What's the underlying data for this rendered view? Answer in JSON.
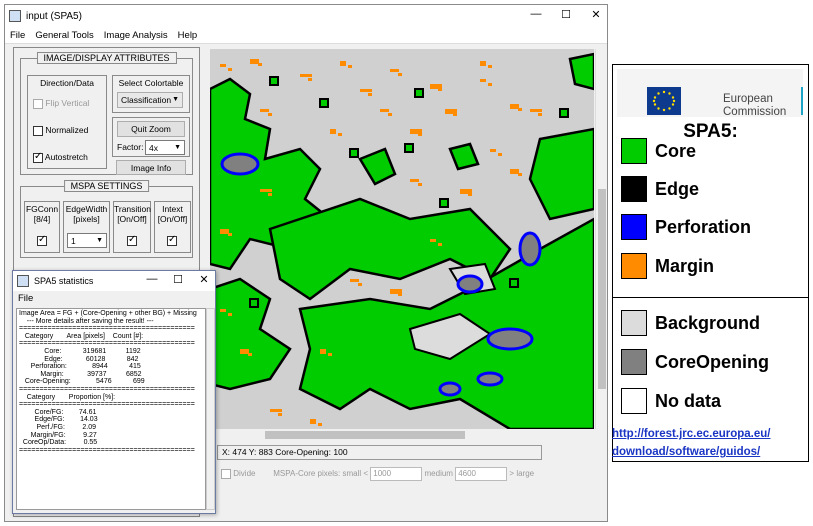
{
  "main_window": {
    "title": "input (SPA5)",
    "controls": {
      "minimize": "—",
      "maximize": "☐",
      "close": "✕"
    },
    "menu": [
      "File",
      "General Tools",
      "Image Analysis",
      "Help"
    ]
  },
  "image_display": {
    "title": "IMAGE/DISPLAY ATTRIBUTES",
    "direction_data": {
      "title": "Direction/Data",
      "flip_vertical": "Flip Vertical",
      "normalized": "Normalized",
      "autostretch": "Autostretch"
    },
    "colortable": {
      "title": "Select Colortable",
      "value": "Classification"
    },
    "quit_zoom": "Quit Zoom",
    "factor_label": "Factor:",
    "factor_value": "4x",
    "image_info": "Image Info"
  },
  "mspa": {
    "title": "MSPA SETTINGS",
    "fgconn": [
      "FGConn",
      "[8/4]"
    ],
    "edgewidth": [
      "EdgeWidth",
      "[pixels]"
    ],
    "edgewidth_value": "1",
    "transition": [
      "Transition",
      "[On/Off]"
    ],
    "intext": [
      "Intext",
      "[On/Off]"
    ]
  },
  "status": {
    "coords": "X: 474   Y: 883   Core-Opening: 100",
    "divide": "Divide",
    "mspa_core_pixels": "MSPA-Core pixels:",
    "small": "small <",
    "small_value": "1000",
    "medium": "medium",
    "medium_value": "4600",
    "large": "> large"
  },
  "stats_window": {
    "title": "SPA5 statistics",
    "menu_file": "File",
    "text": "Image Area = FG + (Core-Opening + other BG) + Missing\n    --- More details after saving the result! ---\n===========================================\n   Category       Area [pixels]    Count [#]:\n===========================================\n             Core:           319681          1192\n             Edge:            60128           842\n      Perforation:             8944           415\n           Margin:            39737          6852\n   Core-Opening:             5476           699\n===========================================\n    Category       Proportion [%]:\n===========================================\n        Core/FG:        74.61\n        Edge/FG:        14.03\n         Perf./FG:         2.09\n      Margin/FG:         9.27\n  CoreOp/Data:         0.55\n==========================================="
  },
  "legend": {
    "eu_line1": "European",
    "eu_line2": "Commission",
    "title": "SPA5:",
    "items": [
      {
        "label": "Core",
        "color": "#00cc00"
      },
      {
        "label": "Edge",
        "color": "#000000"
      },
      {
        "label": "Perforation",
        "color": "#0000ff"
      },
      {
        "label": "Margin",
        "color": "#ff8c00"
      },
      {
        "label": "Background",
        "color": "#dcdcdc"
      },
      {
        "label": "CoreOpening",
        "color": "#808080"
      },
      {
        "label": "No data",
        "color": "#ffffff"
      }
    ],
    "url_line1": "http://forest.jrc.ec.europa.eu/",
    "url_line2": "download/software/guidos/"
  },
  "map_colors": {
    "core": "#00cc00",
    "edge": "#000000",
    "perforation": "#0000ff",
    "margin": "#ff8c00",
    "background": "#d0d0d0",
    "core_opening": "#808080"
  }
}
